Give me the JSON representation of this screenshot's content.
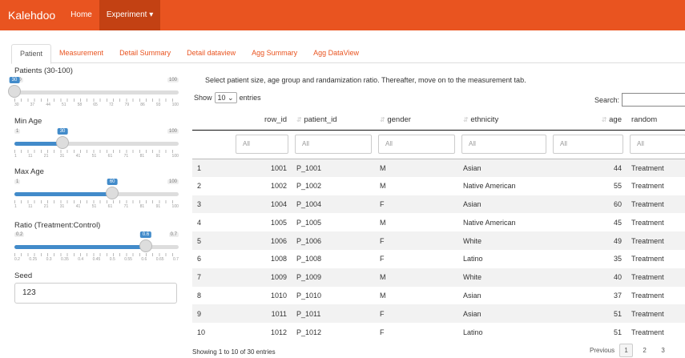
{
  "navbar": {
    "brand": "Kalehdoo",
    "items": [
      "Home",
      "Experiment ▾"
    ]
  },
  "tabs": [
    "Patient",
    "Measurement",
    "Detail Summary",
    "Detail dataview",
    "Agg Summary",
    "Agg DataView"
  ],
  "sidebar": {
    "patients": {
      "label": "Patients (30-100)",
      "min": "30",
      "max": "100",
      "value": "30",
      "fraction": 0.0,
      "grid": [
        "30",
        "37",
        "44",
        "51",
        "58",
        "65",
        "72",
        "79",
        "86",
        "93",
        "100"
      ]
    },
    "min_age": {
      "label": "Min Age",
      "min": "1",
      "max": "100",
      "value": "30",
      "fraction": 0.293,
      "grid": [
        "1",
        "11",
        "21",
        "31",
        "41",
        "51",
        "61",
        "71",
        "81",
        "91",
        "100"
      ]
    },
    "max_age": {
      "label": "Max Age",
      "min": "1",
      "max": "100",
      "value": "60",
      "fraction": 0.596,
      "grid": [
        "1",
        "11",
        "21",
        "31",
        "41",
        "51",
        "61",
        "71",
        "81",
        "91",
        "100"
      ]
    },
    "ratio": {
      "label": "Ratio (Treatment:Control)",
      "min": "0.2",
      "max": "0.7",
      "value": "0.6",
      "fraction": 0.8,
      "grid": [
        "0.2",
        "0.25",
        "0.3",
        "0.35",
        "0.4",
        "0.45",
        "0.5",
        "0.55",
        "0.6",
        "0.65",
        "0.7"
      ]
    },
    "seed": {
      "label": "Seed",
      "value": "123"
    }
  },
  "main": {
    "intro": "Select patient size, age group and randamization ratio. Thereafter, move on to the measurement tab.",
    "show_label": "Show",
    "entries_value": "10",
    "entries_label": "entries",
    "search_label": "Search:",
    "columns": [
      "",
      "row_id",
      "patient_id",
      "gender",
      "ethnicity",
      "age",
      "random"
    ],
    "filter_placeholder": "All",
    "rows": [
      [
        "1",
        "1001",
        "P_1001",
        "M",
        "Asian",
        "44",
        "Treatment"
      ],
      [
        "2",
        "1002",
        "P_1002",
        "M",
        "Native American",
        "55",
        "Treatment"
      ],
      [
        "3",
        "1004",
        "P_1004",
        "F",
        "Asian",
        "60",
        "Treatment"
      ],
      [
        "4",
        "1005",
        "P_1005",
        "M",
        "Native American",
        "45",
        "Treatment"
      ],
      [
        "5",
        "1006",
        "P_1006",
        "F",
        "White",
        "49",
        "Treatment"
      ],
      [
        "6",
        "1008",
        "P_1008",
        "F",
        "Latino",
        "35",
        "Treatment"
      ],
      [
        "7",
        "1009",
        "P_1009",
        "M",
        "White",
        "40",
        "Treatment"
      ],
      [
        "8",
        "1010",
        "P_1010",
        "M",
        "Asian",
        "37",
        "Treatment"
      ],
      [
        "9",
        "1011",
        "P_1011",
        "F",
        "Asian",
        "51",
        "Treatment"
      ],
      [
        "10",
        "1012",
        "P_1012",
        "F",
        "Latino",
        "51",
        "Treatment"
      ]
    ],
    "info": "Showing 1 to 10 of 30 entries",
    "pager": {
      "previous": "Previous",
      "pages": [
        "1",
        "2",
        "3"
      ]
    }
  },
  "colors": {
    "accent": "#e95420",
    "slider": "#428bca"
  }
}
